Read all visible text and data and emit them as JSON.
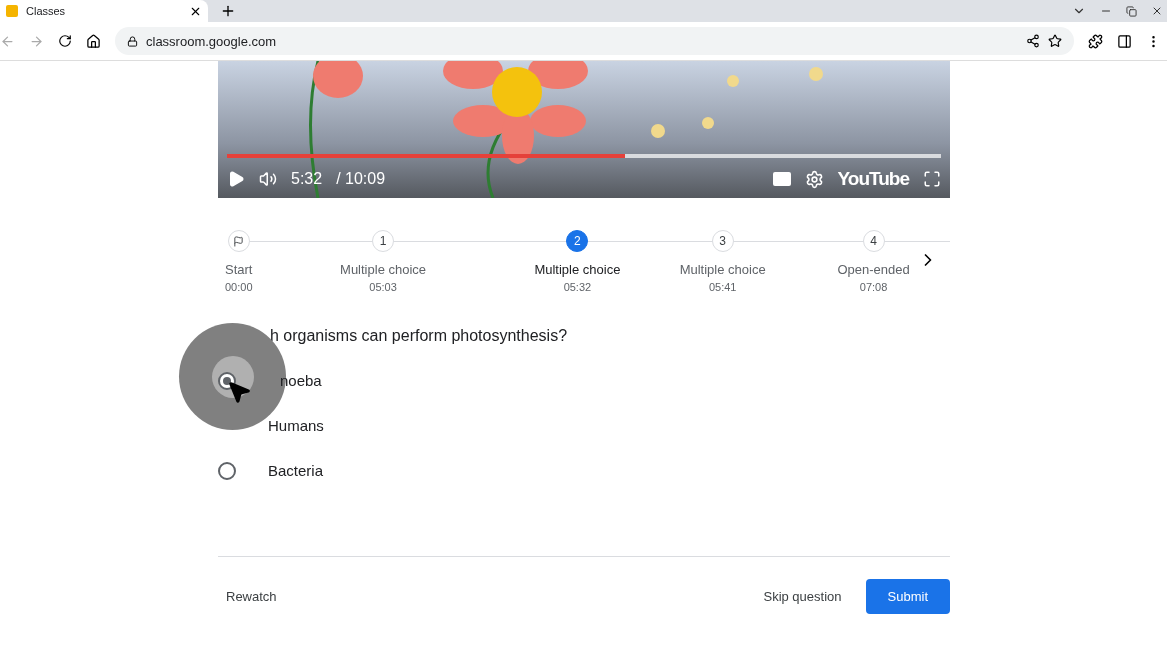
{
  "browser": {
    "tab_title": "Classes",
    "url": "classroom.google.com"
  },
  "video": {
    "level": 0.557,
    "current_time": "5:32",
    "duration": "/ 10:09",
    "brand": "YouTube"
  },
  "timeline": [
    {
      "kind": "start",
      "label": "Start",
      "time": "00:00",
      "selected": false
    },
    {
      "kind": "question",
      "marker": "1",
      "label": "Multiple choice",
      "time": "05:03",
      "selected": false
    },
    {
      "kind": "question",
      "marker": "2",
      "label": "Multiple choice",
      "time": "05:32",
      "selected": true
    },
    {
      "kind": "question",
      "marker": "3",
      "label": "Multiple choice",
      "time": "05:41",
      "selected": false
    },
    {
      "kind": "question",
      "marker": "4",
      "label": "Open-ended",
      "time": "07:08",
      "selected": false
    }
  ],
  "question": {
    "text": "h organisms can perform photosynthesis?",
    "options": [
      {
        "label": "noeba",
        "selected": true
      },
      {
        "label": "Humans"
      },
      {
        "label": "Bacteria",
        "selected": false
      }
    ]
  },
  "footer": {
    "rewatch": "Rewatch",
    "skip": "Skip question",
    "submit": "Submit"
  }
}
